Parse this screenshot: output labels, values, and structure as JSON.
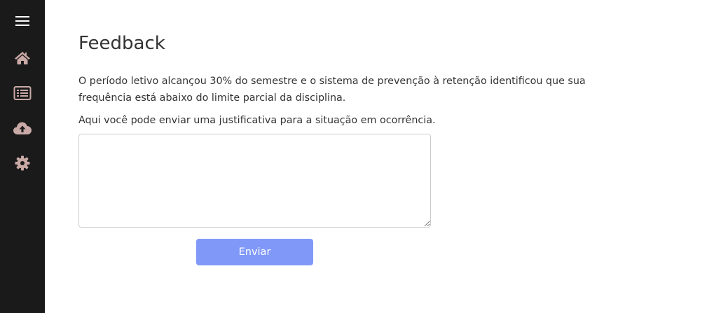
{
  "sidebar": {
    "items": [
      {
        "icon": "menu-icon"
      },
      {
        "icon": "home-icon"
      },
      {
        "icon": "list-icon"
      },
      {
        "icon": "cloud-upload-icon"
      },
      {
        "icon": "gear-icon"
      }
    ],
    "icon_color": "#c9a9a6",
    "menu_icon_color": "#ffffff",
    "background": "#1a1a1a"
  },
  "main": {
    "title": "Feedback",
    "paragraph": "O período letivo alcançou 30% do semestre e o sistema de prevenção à retenção identificou que sua frequência está abaixo do limite parcial da disciplina.",
    "instruction": "Aqui você pode enviar uma justificativa para a situação em ocorrência.",
    "justification": {
      "value": "",
      "placeholder": ""
    },
    "send_label": "Enviar",
    "button_color": "#8099f8"
  }
}
